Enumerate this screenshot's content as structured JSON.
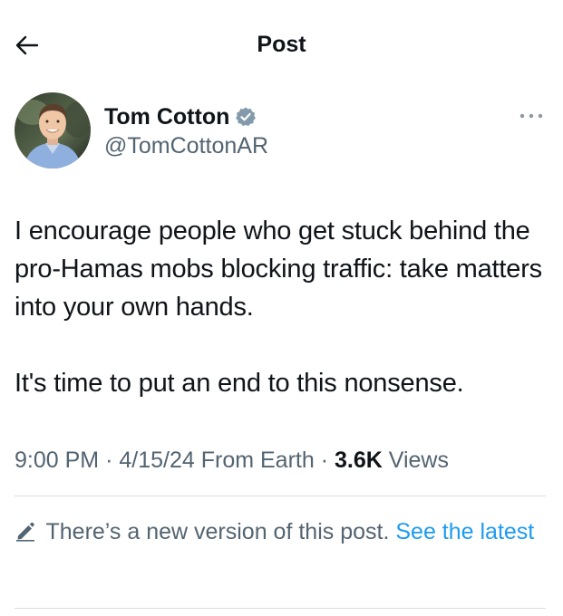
{
  "header": {
    "title": "Post",
    "back_icon": "arrow-left-icon"
  },
  "author": {
    "display_name": "Tom Cotton",
    "handle": "@TomCottonAR",
    "verified_icon": "verified-badge-icon",
    "verified_color": "#829aab",
    "more_icon": "more-horizontal-icon"
  },
  "post": {
    "paragraph_1": "I encourage people who get stuck behind the pro-Hamas mobs blocking traffic: take matters into your own hands.",
    "paragraph_2": "It's time to put an end to this nonsense."
  },
  "meta": {
    "time": "9:00 PM",
    "date": "4/15/24",
    "source": "From Earth",
    "views_count": "3.6K",
    "views_label": "Views",
    "separator": "·"
  },
  "notice": {
    "icon": "pencil-icon",
    "text": "There’s a new version of this post.",
    "link_text": "See the latest",
    "link_color": "#1d9bf0"
  }
}
